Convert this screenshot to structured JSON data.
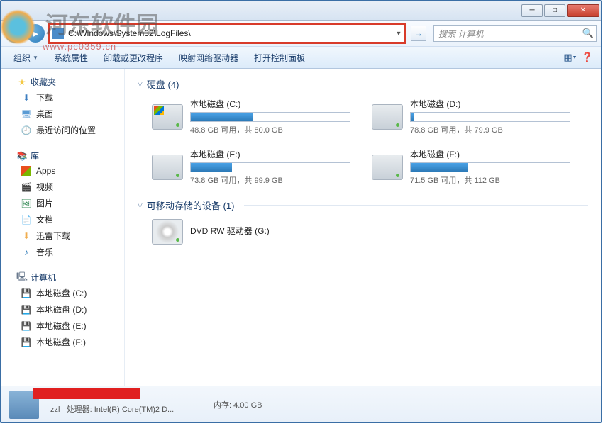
{
  "watermark": {
    "text": "河东软件园",
    "url": "www.pc0359.cn"
  },
  "address": "C:\\Windows\\System32\\LogFiles\\",
  "search_placeholder": "搜索 计算机",
  "toolbar": {
    "organize": "组织",
    "props": "系统属性",
    "uninstall": "卸载或更改程序",
    "netdrive": "映射网络驱动器",
    "cpanel": "打开控制面板"
  },
  "sidebar": {
    "fav": "收藏夹",
    "fav_items": {
      "downloads": "下载",
      "desktop": "桌面",
      "recent": "最近访问的位置"
    },
    "lib": "库",
    "lib_items": {
      "apps": "Apps",
      "video": "视频",
      "pics": "图片",
      "docs": "文档",
      "xunlei": "迅雷下载",
      "music": "音乐"
    },
    "comp": "计算机",
    "comp_items": {
      "c": "本地磁盘 (C:)",
      "d": "本地磁盘 (D:)",
      "e": "本地磁盘 (E:)",
      "f": "本地磁盘 (F:)"
    }
  },
  "groups": {
    "hdd": "硬盘 (4)",
    "removable": "可移动存储的设备 (1)"
  },
  "drives": [
    {
      "name": "本地磁盘 (C:)",
      "stat": "48.8 GB 可用，共 80.0 GB",
      "fill": 39
    },
    {
      "name": "本地磁盘 (D:)",
      "stat": "78.8 GB 可用，共 79.9 GB",
      "fill": 2
    },
    {
      "name": "本地磁盘 (E:)",
      "stat": "73.8 GB 可用，共 99.9 GB",
      "fill": 26
    },
    {
      "name": "本地磁盘 (F:)",
      "stat": "71.5 GB 可用，共 112 GB",
      "fill": 36
    }
  ],
  "dvd": "DVD RW 驱动器 (G:)",
  "footer": {
    "name": "zzl",
    "cpu_label": "处理器:",
    "cpu": "Intel(R) Core(TM)2 D...",
    "mem_label": "内存:",
    "mem": "4.00 GB"
  }
}
